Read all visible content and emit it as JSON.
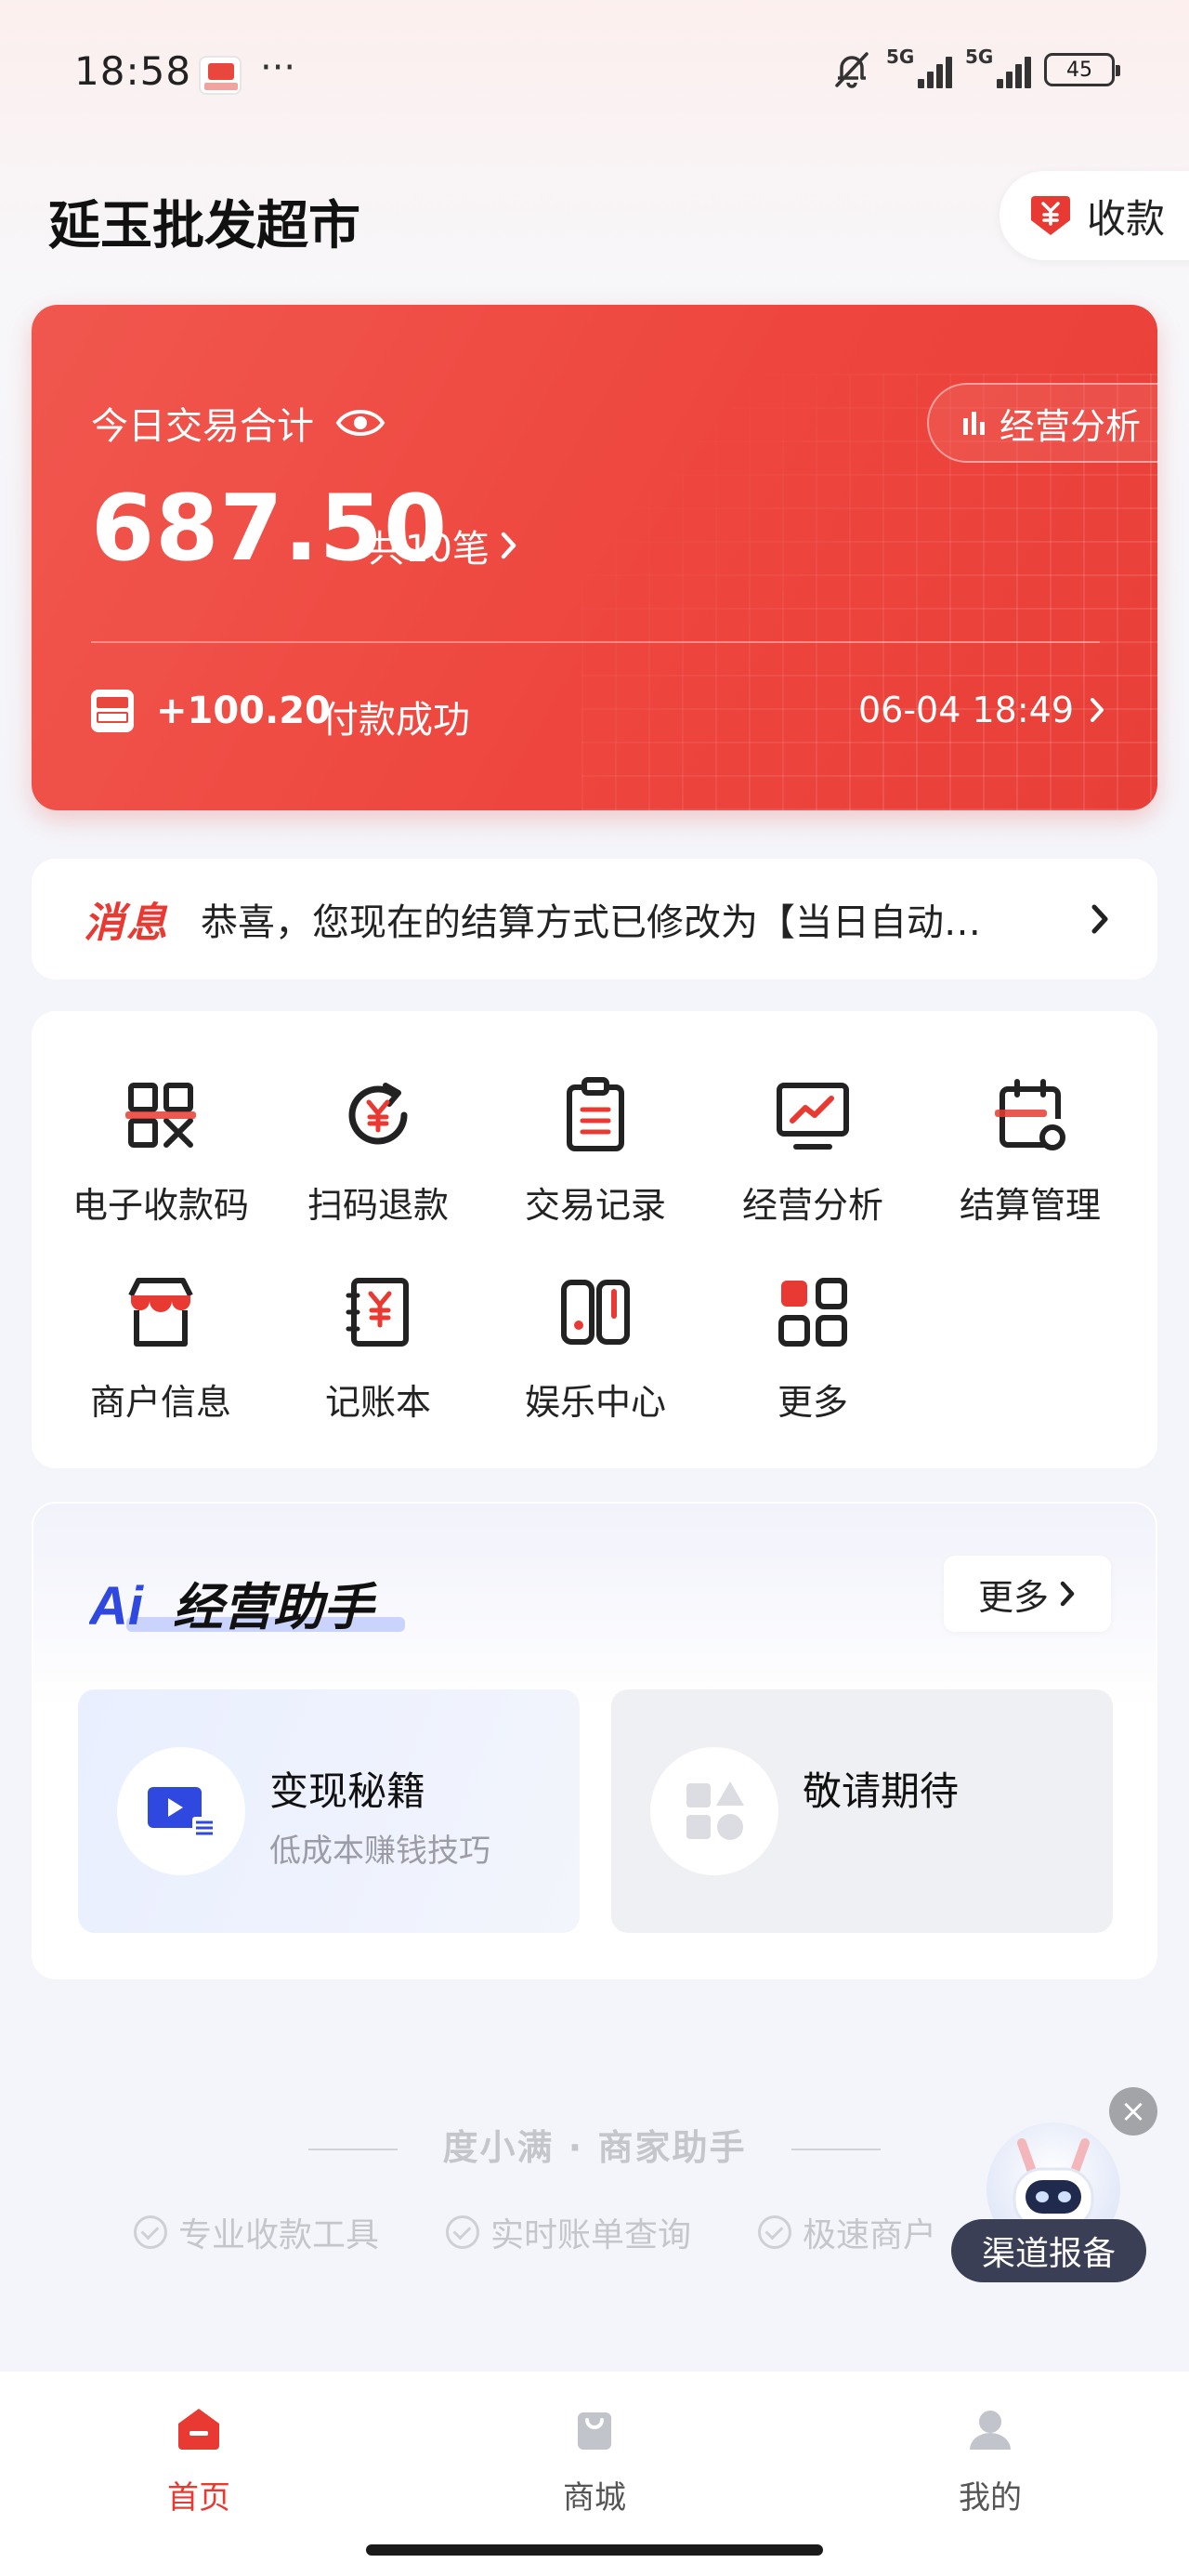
{
  "status_bar": {
    "time": "18:58",
    "more": "···",
    "sim1": "5G",
    "sim2": "5G",
    "battery": "45"
  },
  "header": {
    "store_name": "延玉批发超市",
    "collect_label": "收款"
  },
  "summary": {
    "label": "今日交易合计",
    "analysis_label": "经营分析",
    "amount": "687.50",
    "count": "共10笔",
    "latest_amount": "+100.20",
    "latest_status": "付款成功",
    "latest_time": "06-04 18:49"
  },
  "message": {
    "tag": "消息",
    "text": "恭喜，您现在的结算方式已修改为【当日自动…"
  },
  "menu": [
    {
      "label": "电子收款码",
      "icon": "qrcode-icon"
    },
    {
      "label": "扫码退款",
      "icon": "refund-icon"
    },
    {
      "label": "交易记录",
      "icon": "clipboard-icon"
    },
    {
      "label": "经营分析",
      "icon": "monitor-chart-icon"
    },
    {
      "label": "结算管理",
      "icon": "calendar-gear-icon"
    },
    {
      "label": "商户信息",
      "icon": "store-icon"
    },
    {
      "label": "记账本",
      "icon": "ledger-icon"
    },
    {
      "label": "娱乐中心",
      "icon": "gamepad-icon"
    },
    {
      "label": "更多",
      "icon": "grid-icon"
    }
  ],
  "ai_assistant": {
    "title": "经营助手",
    "title_prefix": "Ai",
    "more_label": "更多",
    "tiles": [
      {
        "title": "变现秘籍",
        "subtitle": "低成本赚钱技巧"
      },
      {
        "title": "敬请期待",
        "subtitle": ""
      }
    ]
  },
  "footer": {
    "slogan": "度小满 · 商家助手",
    "features": [
      "专业收款工具",
      "实时账单查询",
      "极速商户"
    ]
  },
  "floating": {
    "label": "渠道报备",
    "close": "×"
  },
  "bottom_nav": [
    {
      "label": "首页",
      "active": true
    },
    {
      "label": "商城",
      "active": false
    },
    {
      "label": "我的",
      "active": false
    }
  ],
  "colors": {
    "accent": "#e83a32",
    "hero": "#ee463e",
    "ai_blue": "#2f48e0"
  }
}
